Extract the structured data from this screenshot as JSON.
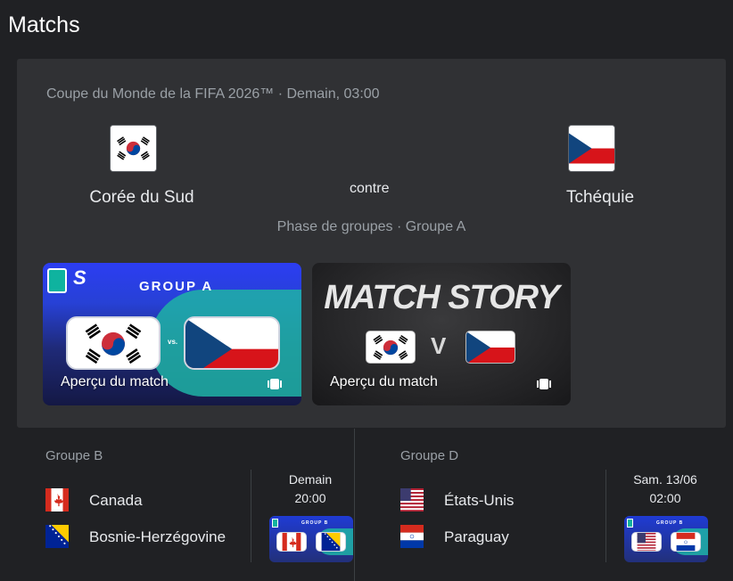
{
  "page": {
    "title": "Matchs"
  },
  "featured": {
    "competition_meta": "Coupe du Monde de la FIFA 2026™ · Demain, 03:00",
    "home": {
      "name": "Corée du Sud",
      "flag": "south-korea-flag-icon"
    },
    "away": {
      "name": "Tchéquie",
      "flag": "czechia-flag-icon"
    },
    "versus": "contre",
    "stage": "Phase de groupes · Groupe A",
    "videos": [
      {
        "label": "Aperçu du match",
        "overlay_text": "GROUP A"
      },
      {
        "label": "Aperçu du match",
        "overlay_text": "MATCH STORY",
        "vs": "V"
      }
    ]
  },
  "fixtures": [
    {
      "group": "Groupe B",
      "teams": [
        {
          "name": "Canada",
          "flag": "canada-flag-icon"
        },
        {
          "name": "Bosnie-Herzégovine",
          "flag": "bosnia-flag-icon"
        }
      ],
      "day": "Demain",
      "time": "20:00",
      "thumb_text": "GROUP B"
    },
    {
      "group": "Groupe D",
      "teams": [
        {
          "name": "États-Unis",
          "flag": "usa-flag-icon"
        },
        {
          "name": "Paraguay",
          "flag": "paraguay-flag-icon"
        }
      ],
      "day": "Sam. 13/06",
      "time": "02:00",
      "thumb_text": "GROUP B"
    }
  ],
  "colors": {
    "background": "#202124",
    "card": "#303134",
    "muted_text": "#9aa0a6",
    "teal_accent": "#1fb3a6",
    "brand_blue": "#2c3df2"
  }
}
